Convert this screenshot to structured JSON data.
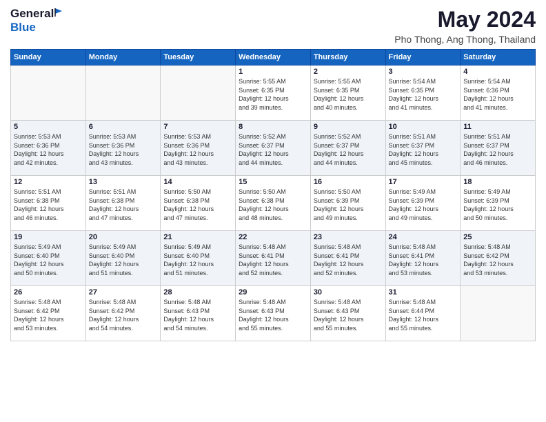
{
  "logo": {
    "general": "General",
    "blue": "Blue"
  },
  "title": "May 2024",
  "subtitle": "Pho Thong, Ang Thong, Thailand",
  "days_header": [
    "Sunday",
    "Monday",
    "Tuesday",
    "Wednesday",
    "Thursday",
    "Friday",
    "Saturday"
  ],
  "weeks": [
    [
      {
        "day": "",
        "info": ""
      },
      {
        "day": "",
        "info": ""
      },
      {
        "day": "",
        "info": ""
      },
      {
        "day": "1",
        "info": "Sunrise: 5:55 AM\nSunset: 6:35 PM\nDaylight: 12 hours\nand 39 minutes."
      },
      {
        "day": "2",
        "info": "Sunrise: 5:55 AM\nSunset: 6:35 PM\nDaylight: 12 hours\nand 40 minutes."
      },
      {
        "day": "3",
        "info": "Sunrise: 5:54 AM\nSunset: 6:35 PM\nDaylight: 12 hours\nand 41 minutes."
      },
      {
        "day": "4",
        "info": "Sunrise: 5:54 AM\nSunset: 6:36 PM\nDaylight: 12 hours\nand 41 minutes."
      }
    ],
    [
      {
        "day": "5",
        "info": "Sunrise: 5:53 AM\nSunset: 6:36 PM\nDaylight: 12 hours\nand 42 minutes."
      },
      {
        "day": "6",
        "info": "Sunrise: 5:53 AM\nSunset: 6:36 PM\nDaylight: 12 hours\nand 43 minutes."
      },
      {
        "day": "7",
        "info": "Sunrise: 5:53 AM\nSunset: 6:36 PM\nDaylight: 12 hours\nand 43 minutes."
      },
      {
        "day": "8",
        "info": "Sunrise: 5:52 AM\nSunset: 6:37 PM\nDaylight: 12 hours\nand 44 minutes."
      },
      {
        "day": "9",
        "info": "Sunrise: 5:52 AM\nSunset: 6:37 PM\nDaylight: 12 hours\nand 44 minutes."
      },
      {
        "day": "10",
        "info": "Sunrise: 5:51 AM\nSunset: 6:37 PM\nDaylight: 12 hours\nand 45 minutes."
      },
      {
        "day": "11",
        "info": "Sunrise: 5:51 AM\nSunset: 6:37 PM\nDaylight: 12 hours\nand 46 minutes."
      }
    ],
    [
      {
        "day": "12",
        "info": "Sunrise: 5:51 AM\nSunset: 6:38 PM\nDaylight: 12 hours\nand 46 minutes."
      },
      {
        "day": "13",
        "info": "Sunrise: 5:51 AM\nSunset: 6:38 PM\nDaylight: 12 hours\nand 47 minutes."
      },
      {
        "day": "14",
        "info": "Sunrise: 5:50 AM\nSunset: 6:38 PM\nDaylight: 12 hours\nand 47 minutes."
      },
      {
        "day": "15",
        "info": "Sunrise: 5:50 AM\nSunset: 6:38 PM\nDaylight: 12 hours\nand 48 minutes."
      },
      {
        "day": "16",
        "info": "Sunrise: 5:50 AM\nSunset: 6:39 PM\nDaylight: 12 hours\nand 49 minutes."
      },
      {
        "day": "17",
        "info": "Sunrise: 5:49 AM\nSunset: 6:39 PM\nDaylight: 12 hours\nand 49 minutes."
      },
      {
        "day": "18",
        "info": "Sunrise: 5:49 AM\nSunset: 6:39 PM\nDaylight: 12 hours\nand 50 minutes."
      }
    ],
    [
      {
        "day": "19",
        "info": "Sunrise: 5:49 AM\nSunset: 6:40 PM\nDaylight: 12 hours\nand 50 minutes."
      },
      {
        "day": "20",
        "info": "Sunrise: 5:49 AM\nSunset: 6:40 PM\nDaylight: 12 hours\nand 51 minutes."
      },
      {
        "day": "21",
        "info": "Sunrise: 5:49 AM\nSunset: 6:40 PM\nDaylight: 12 hours\nand 51 minutes."
      },
      {
        "day": "22",
        "info": "Sunrise: 5:48 AM\nSunset: 6:41 PM\nDaylight: 12 hours\nand 52 minutes."
      },
      {
        "day": "23",
        "info": "Sunrise: 5:48 AM\nSunset: 6:41 PM\nDaylight: 12 hours\nand 52 minutes."
      },
      {
        "day": "24",
        "info": "Sunrise: 5:48 AM\nSunset: 6:41 PM\nDaylight: 12 hours\nand 53 minutes."
      },
      {
        "day": "25",
        "info": "Sunrise: 5:48 AM\nSunset: 6:42 PM\nDaylight: 12 hours\nand 53 minutes."
      }
    ],
    [
      {
        "day": "26",
        "info": "Sunrise: 5:48 AM\nSunset: 6:42 PM\nDaylight: 12 hours\nand 53 minutes."
      },
      {
        "day": "27",
        "info": "Sunrise: 5:48 AM\nSunset: 6:42 PM\nDaylight: 12 hours\nand 54 minutes."
      },
      {
        "day": "28",
        "info": "Sunrise: 5:48 AM\nSunset: 6:43 PM\nDaylight: 12 hours\nand 54 minutes."
      },
      {
        "day": "29",
        "info": "Sunrise: 5:48 AM\nSunset: 6:43 PM\nDaylight: 12 hours\nand 55 minutes."
      },
      {
        "day": "30",
        "info": "Sunrise: 5:48 AM\nSunset: 6:43 PM\nDaylight: 12 hours\nand 55 minutes."
      },
      {
        "day": "31",
        "info": "Sunrise: 5:48 AM\nSunset: 6:44 PM\nDaylight: 12 hours\nand 55 minutes."
      },
      {
        "day": "",
        "info": ""
      }
    ]
  ]
}
